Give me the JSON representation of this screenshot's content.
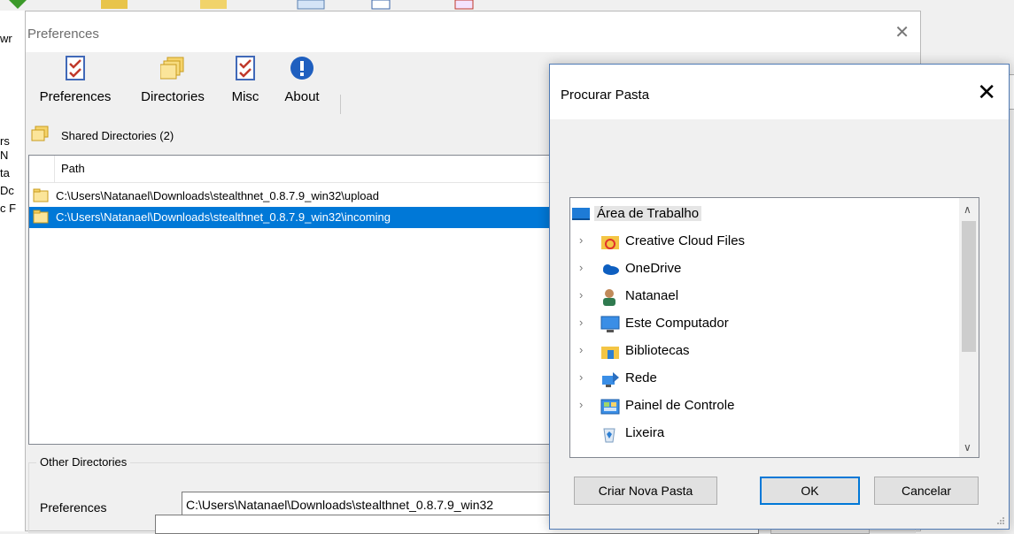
{
  "background": {
    "left_fragments": [
      "rs",
      "N",
      "ta",
      "Dc",
      "c F"
    ],
    "top_left_label": "wr"
  },
  "preferences_window": {
    "title": "Preferences",
    "toolbar": {
      "preferences": "Preferences",
      "directories": "Directories",
      "misc": "Misc",
      "about": "About"
    },
    "shared_directories_label": "Shared Directories (2)",
    "path_header": "Path",
    "paths": [
      "C:\\Users\\Natanael\\Downloads\\stealthnet_0.8.7.9_win32\\upload",
      "C:\\Users\\Natanael\\Downloads\\stealthnet_0.8.7.9_win32\\incoming"
    ],
    "other_directories_label": "Other Directories",
    "preferences_field_label": "Preferences",
    "preferences_field_value": "C:\\Users\\Natanael\\Downloads\\stealthnet_0.8.7.9_win32"
  },
  "browse_dialog": {
    "title": "Procurar Pasta",
    "tree": [
      {
        "label": "Área de Trabalho",
        "icon": "desktop-icon"
      },
      {
        "label": "Creative Cloud Files",
        "icon": "creative-cloud-folder-icon"
      },
      {
        "label": "OneDrive",
        "icon": "onedrive-cloud-icon"
      },
      {
        "label": "Natanael",
        "icon": "user-folder-icon"
      },
      {
        "label": "Este Computador",
        "icon": "computer-icon"
      },
      {
        "label": "Bibliotecas",
        "icon": "libraries-icon"
      },
      {
        "label": "Rede",
        "icon": "network-icon"
      },
      {
        "label": "Painel de Controle",
        "icon": "control-panel-icon"
      },
      {
        "label": "Lixeira",
        "icon": "recycle-bin-icon"
      }
    ],
    "buttons": {
      "new_folder": "Criar Nova Pasta",
      "ok": "OK",
      "cancel": "Cancelar"
    }
  }
}
